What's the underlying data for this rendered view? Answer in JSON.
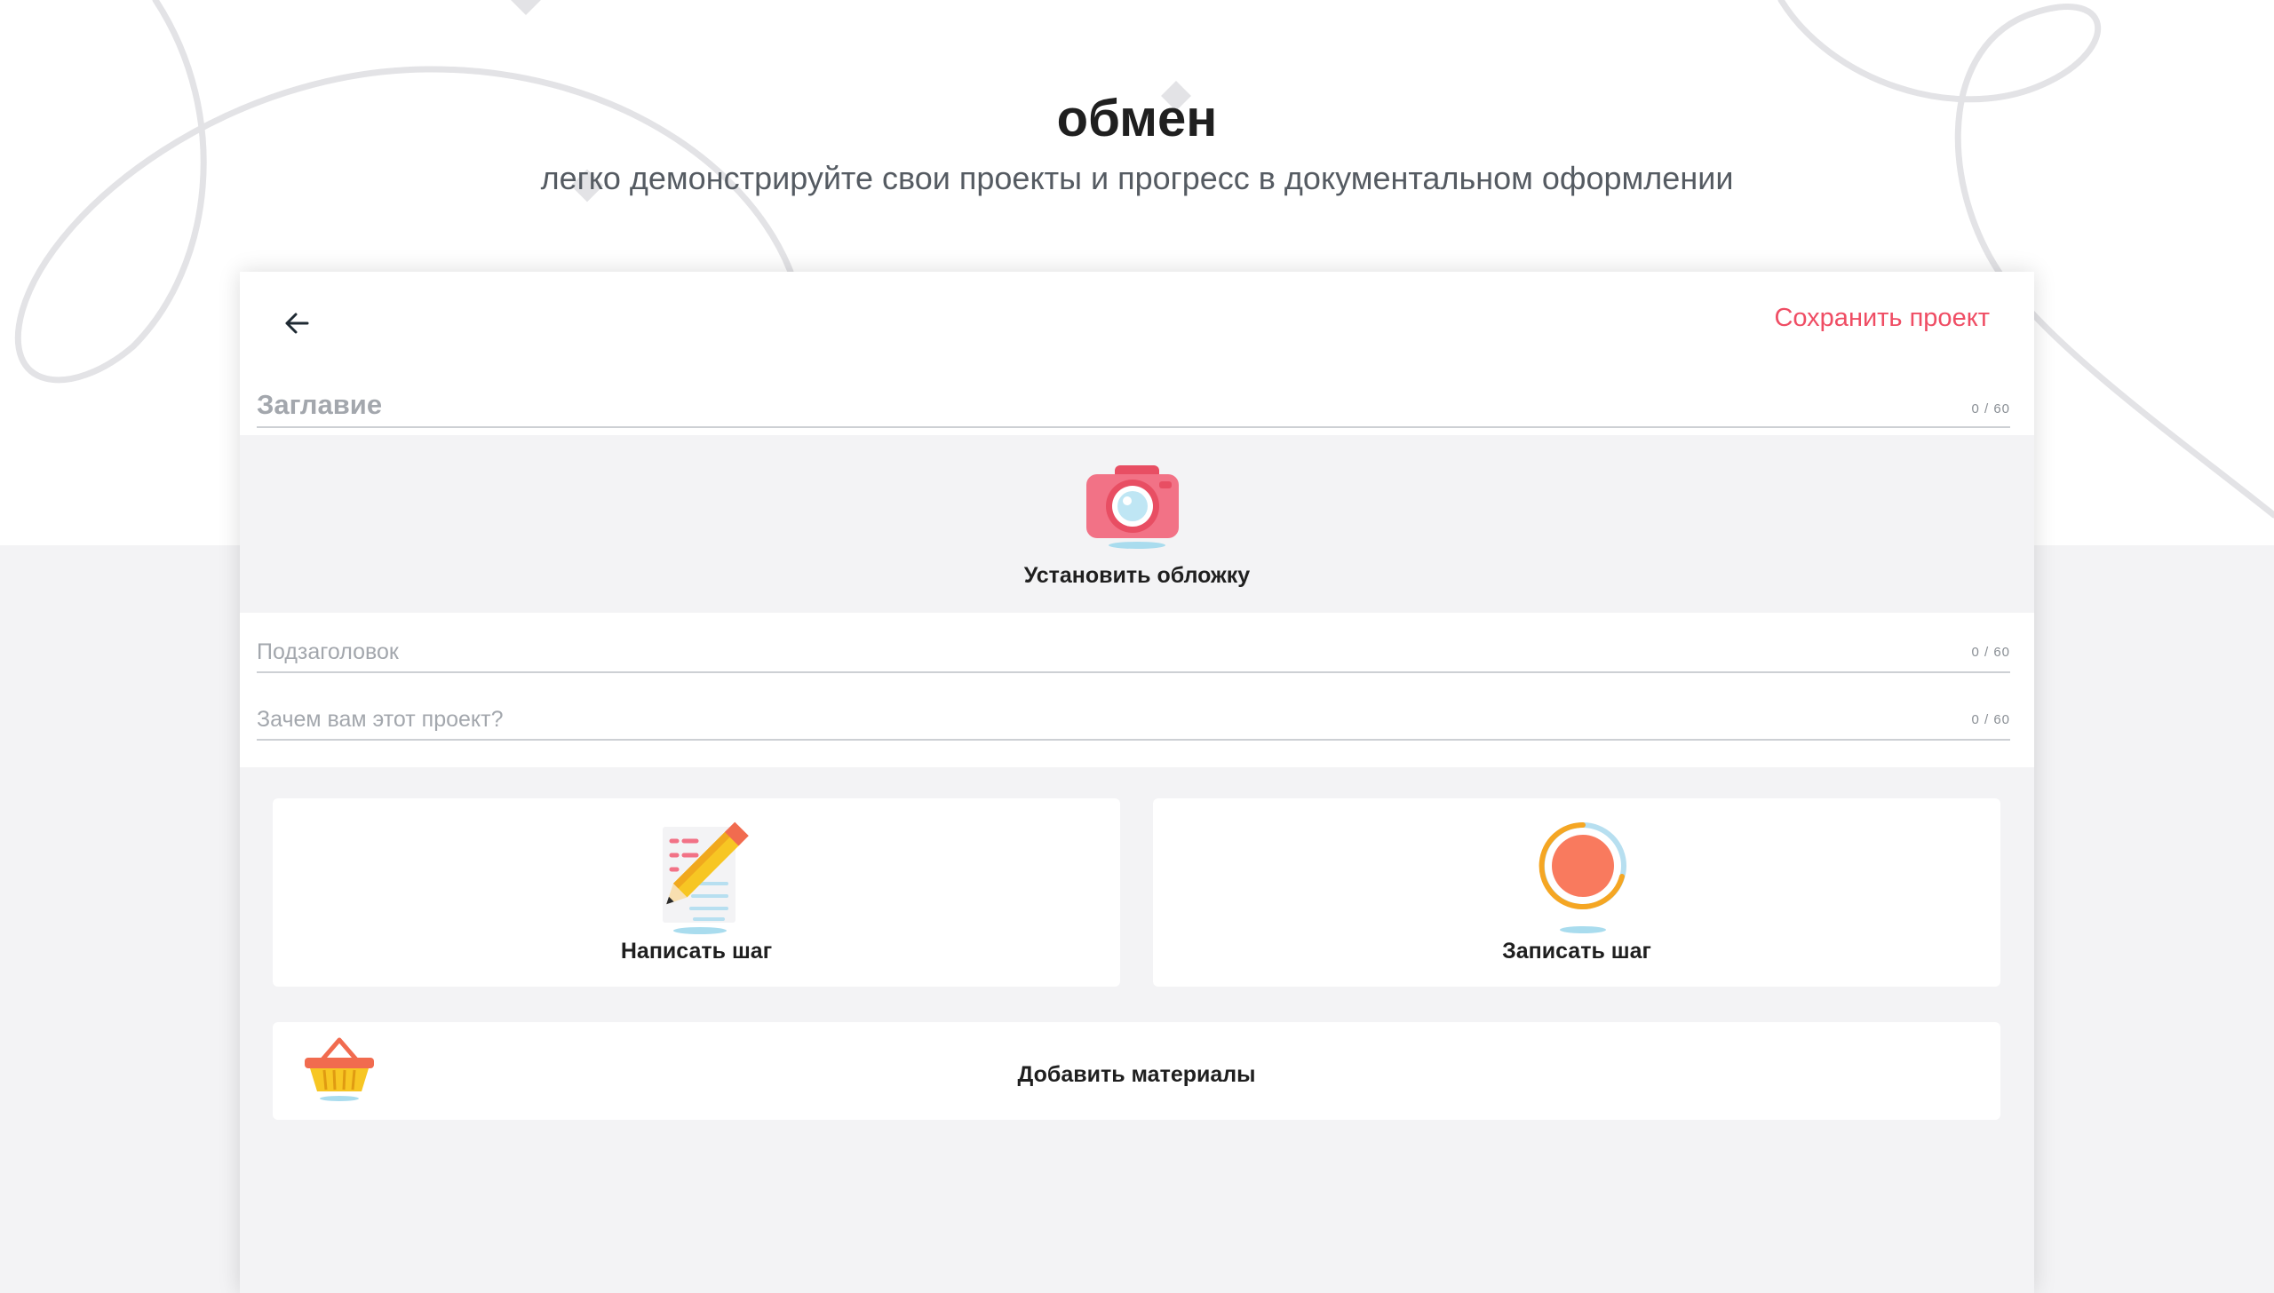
{
  "hero": {
    "title": "обмен",
    "subtitle": "легко демонстрируйте свои проекты и прогресс в документальном оформлении"
  },
  "editor": {
    "back_icon": "arrow-left-icon",
    "save_label": "Сохранить проект",
    "title_field": {
      "placeholder": "Заглавие",
      "counter": "0 / 60"
    },
    "cover": {
      "label": "Установить обложку",
      "icon": "camera-icon"
    },
    "subtitle_field": {
      "placeholder": "Подзаголовок",
      "counter": "0 / 60"
    },
    "why_field": {
      "placeholder": "Зачем вам этот проект?",
      "counter": "0 / 60"
    },
    "actions": {
      "write_step": {
        "label": "Написать шаг",
        "icon": "pencil-notes-icon"
      },
      "record_step": {
        "label": "Записать шаг",
        "icon": "record-icon"
      },
      "add_materials": {
        "label": "Добавить материалы",
        "icon": "basket-icon"
      }
    }
  },
  "colors": {
    "accent": "#ef4d64",
    "page_bg_lower": "#f3f3f5",
    "text_dark": "#1f1f1f",
    "placeholder": "#a3a7ad"
  }
}
